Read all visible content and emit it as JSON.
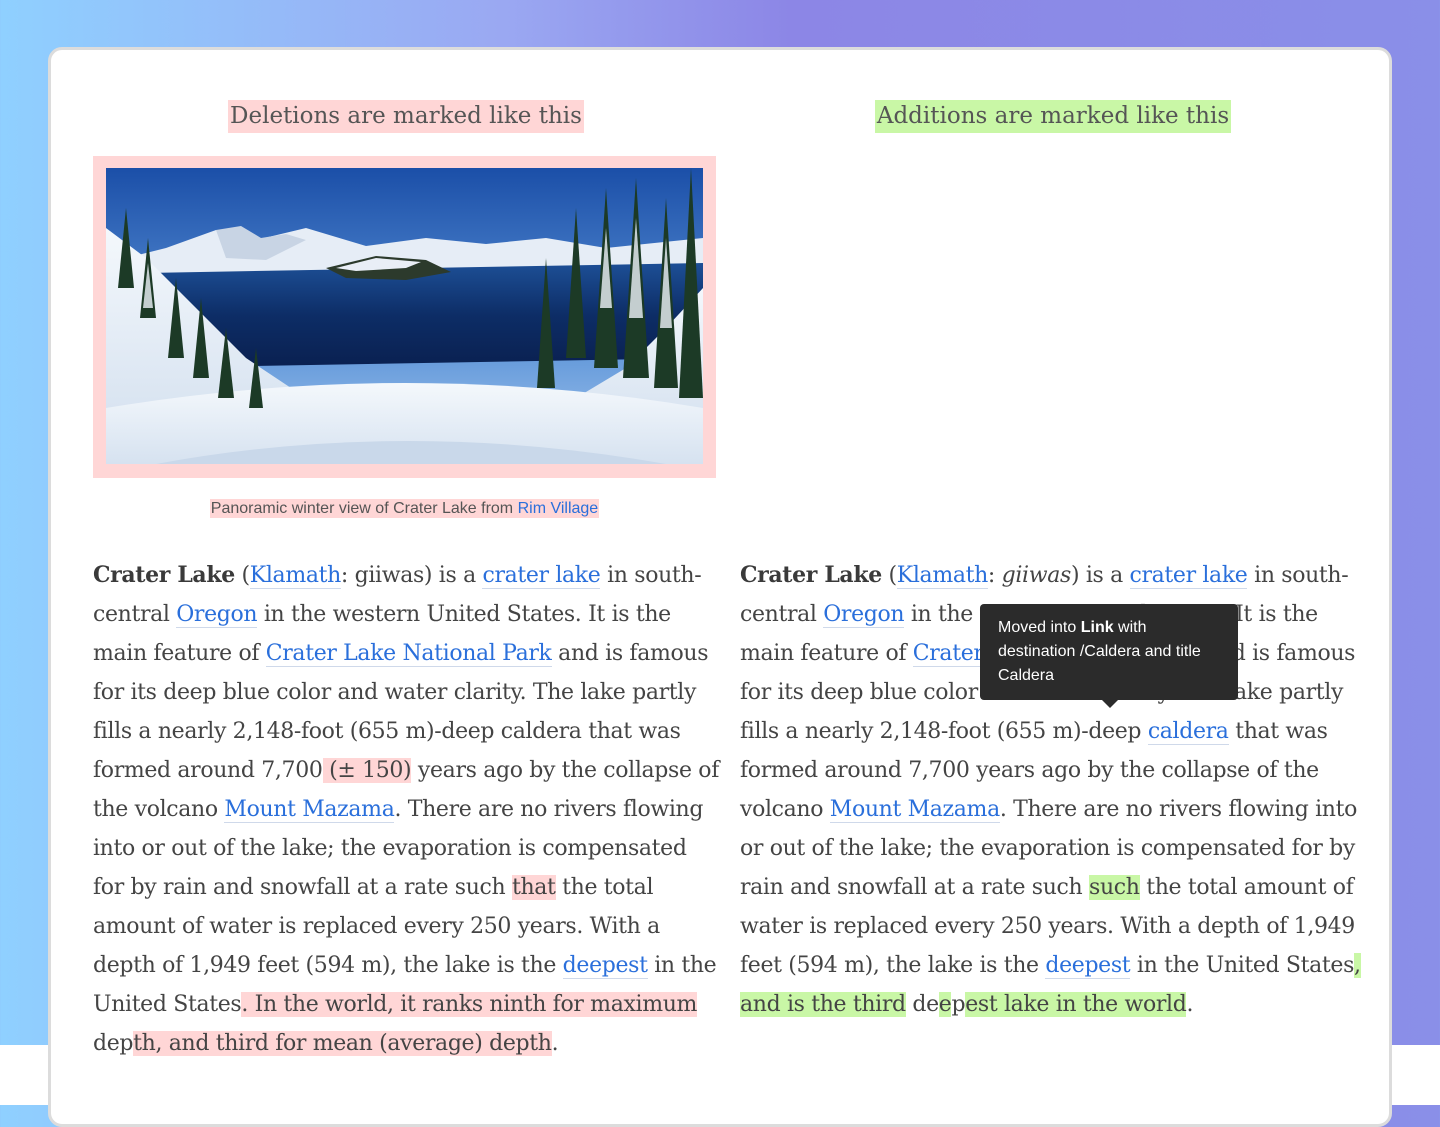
{
  "legend": {
    "deletions_label": "Deletions are marked like this",
    "additions_label": "Additions are marked like this"
  },
  "colors": {
    "deletion_highlight": "#ffd6d6",
    "addition_highlight": "#c9f7a6",
    "link": "#2a6fdb",
    "tooltip_bg": "#2b2b2b"
  },
  "left": {
    "caption_text": "Panoramic winter view of Crater Lake from ",
    "caption_link": "Rim Village",
    "p": {
      "t1": "Crater Lake",
      "t2": " (",
      "l_klamath": "Klamath",
      "t3": ": giiwas) is a ",
      "l_crater_lake": "crater lake",
      "t4": " in south-central ",
      "l_oregon": "Oregon",
      "t5": " in the western United States. It is the main feature of ",
      "l_park": "Crater Lake National Park",
      "t6": " and is famous for its deep blue color and water clarity. The lake partly fills a nearly 2,148-foot (655 m)-deep caldera that was formed around 7,700",
      "d1": " (± 150)",
      "t7": " years ago by the collapse of the volcano ",
      "l_mazama": "Mount Mazama",
      "t8": ". There are no rivers flowing into or out of the lake; the evaporation is compensated for by rain and snowfall at a rate such ",
      "d2": "that",
      "t9": " the total amount of water is replaced every 250 years. With a depth of 1,949 feet (594 m), the lake is the ",
      "l_deepest": "deepest",
      "t10": " in the United States",
      "d3": ". In the world, it ranks ninth for maximum",
      "t11": " dep",
      "d4": "th, and third for mean (average) depth",
      "t12": "."
    }
  },
  "right": {
    "p": {
      "t1": "Crater Lake",
      "t2": " (",
      "l_klamath": "Klamath",
      "t3": ": ",
      "i_giiwas": "giiwas",
      "t4": ") is a ",
      "l_crater_lake": "crater lake",
      "t5": " in south-central ",
      "l_oregon": "Oregon",
      "t6": " in the western United States. It is the main feature of ",
      "l_park": "Crater Lake",
      "t7": " National Park and is famous for its deep blue color and water clarity. The lake partly fills a nearly 2,148-foot (655 m)-deep ",
      "l_caldera": "caldera",
      "t8": " that was formed around 7,700 years ago by the collapse of the volcano ",
      "l_mazama": "Mount Mazama",
      "t9": ". There are no rivers flowing into or out of the lake; the evaporation is compensated for by rain and snowfall at a rate such ",
      "a1": "such",
      "t10": " the total amount of water is replaced every 250 years. With a depth of 1,949 feet (594 m), the lake is the ",
      "l_deepest": "deepest",
      "t11": " in the United States",
      "a2": ", and is the third",
      "t12": " de",
      "a3": "e",
      "t13": "p",
      "a4": "est lake in the world",
      "t14": "."
    }
  },
  "tooltip": {
    "pre": "Moved into ",
    "bold": "Link",
    "post": " with destination /Caldera and title Caldera"
  }
}
